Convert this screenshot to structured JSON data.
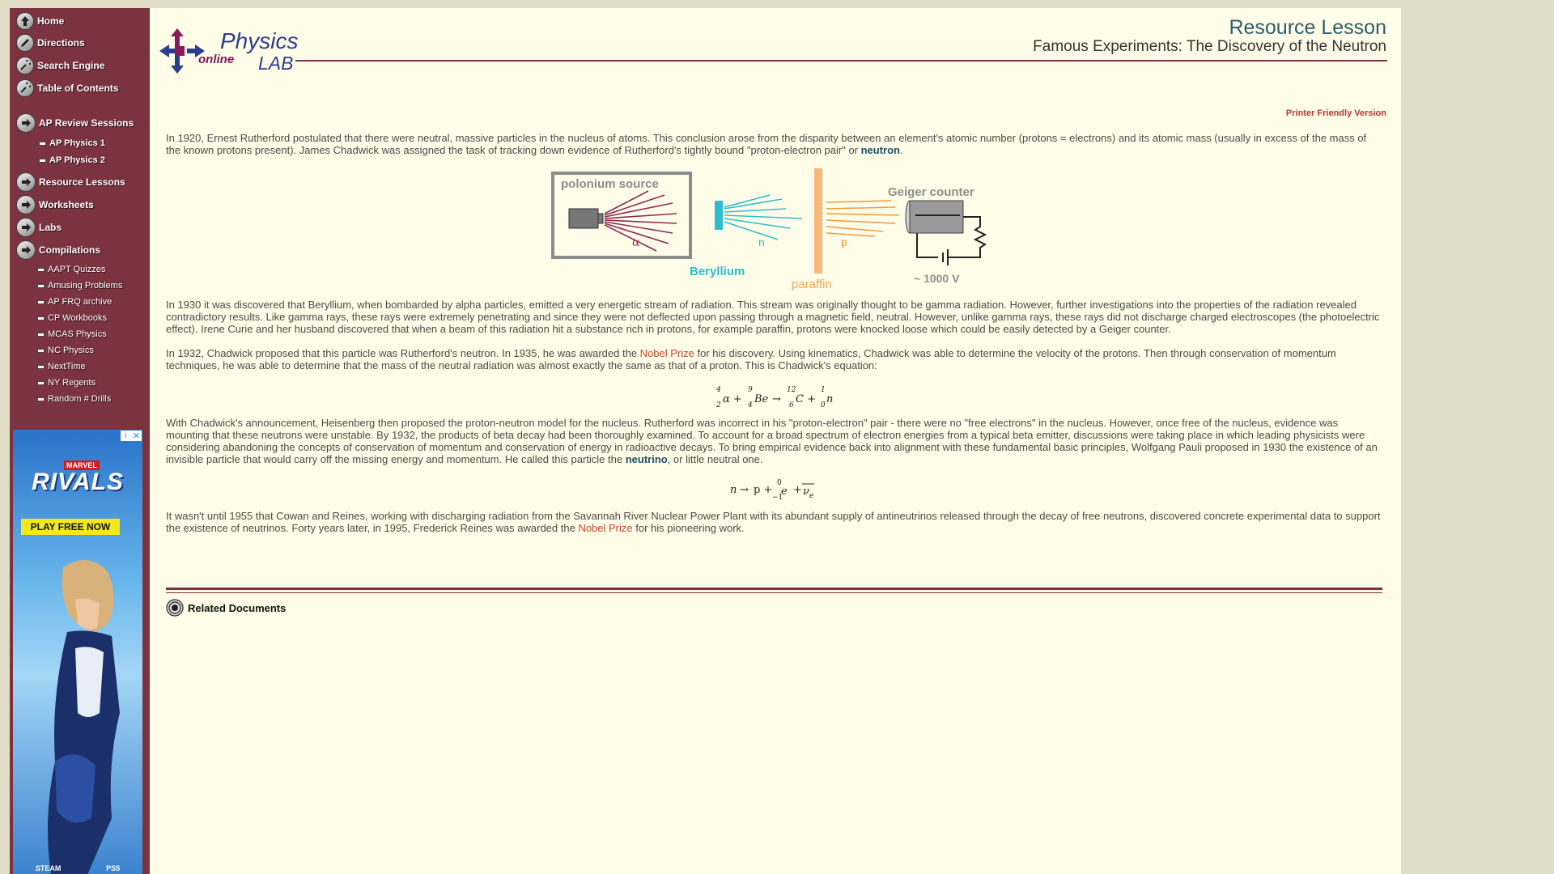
{
  "sidebar": {
    "nav": [
      "Home",
      "Directions",
      "Search Engine",
      "Table of Contents"
    ],
    "ap_review": "AP Review Sessions",
    "ap_sub": [
      "AP Physics 1",
      "AP Physics 2"
    ],
    "sections": [
      "Resource Lessons",
      "Worksheets",
      "Labs",
      "Compilations"
    ],
    "compilations": [
      "AAPT Quizzes",
      "Amusing Problems",
      "AP FRQ archive",
      "CP Workbooks",
      "MCAS Physics",
      "NC Physics",
      "NextTime",
      "NY Regents",
      "Random # Drills"
    ]
  },
  "ad": {
    "marvel": "MARVEL",
    "title": "RIVALS",
    "cta": "PLAY FREE NOW",
    "steam": "STEAM",
    "ps5": "PS5"
  },
  "logo": {
    "physics": "Physics",
    "lab": "LAB",
    "online": "online"
  },
  "header": {
    "title": "Resource Lesson",
    "subtitle": "Famous Experiments: The Discovery of the Neutron"
  },
  "printer_link": "Printer Friendly Version",
  "p1": {
    "a": "In 1920, Ernest Rutherford postulated that there were neutral, massive particles in the nucleus of atoms. This conclusion arose from the disparity between an element's atomic number (protons = electrons) and its atomic mass (usually in excess of the mass of the known protons present). James Chadwick was assigned the task of tracking down evidence of Rutherford's tightly bound \"proton-electron pair\" or ",
    "kw": "neutron",
    "b": "."
  },
  "diagram": {
    "polonium": "polonium source",
    "alpha": "α",
    "beryllium": "Beryllium",
    "n": "n",
    "paraffin": "paraffin",
    "p": "p",
    "geiger": "Geiger counter",
    "voltage": "~ 1000 V"
  },
  "p2": "In 1930 it was discovered that Beryllium, when bombarded by alpha particles, emitted a very energetic stream of radiation. This stream was originally thought to be gamma radiation.  However, further investigations into the properties of the radiation revealed contradictory results. Like gamma rays, these rays were extremely penetrating and since they were not deflected upon passing through a magnetic field, neutral. However, unlike gamma rays, these rays did not discharge charged electroscopes (the photoelectric effect). Irene Curie and her husband discovered that when a beam of this radiation hit a substance rich in protons, for example paraffin, protons were knocked loose which could be easily detected by a Geiger counter.",
  "p3": {
    "a": "In 1932, Chadwick proposed that this particle was Rutherford's neutron. In 1935, he was awarded the ",
    "link": "Nobel Prize",
    "b": " for his discovery. Using kinematics, Chadwick was able to determine the velocity of the protons. Then through conservation of momentum techniques, he was able to determine that the mass of the neutral radiation was almost exactly the same as that of a proton. This is Chadwick's equation:"
  },
  "p4": {
    "a": "With Chadwick's announcement, Heisenberg then proposed the proton-neutron model for the nucleus. Rutherford was incorrect in his \"proton-electron\" pair - there were no \"free electrons\" in the nucleus. However, once free of the nucleus, evidence was mounting that these neutrons were unstable. By 1932, the products of beta decay had been thoroughly examined. To account for a broad spectrum of electron energies from a typical beta emitter, discussions were taking place in which leading physicists were considering abandoning the concepts of conservation of momentum and conservation of energy in radioactive decays. To bring empirical evidence back into alignment with these fundamental basic principles, Wolfgang Pauli proposed in 1930 the existence of an invisible particle that would carry off the missing energy and momentum. He called this particle the ",
    "kw": "neutrino",
    "b": ", or little neutral one."
  },
  "p5": {
    "a": "It wasn't until 1955 that Cowan and Reines, working with discharging radiation from the Savannah River Nuclear Power Plant with its abundant supply of antineutrinos released through the decay of free neutrons, discovered concrete experimental data to support the existence of neutrinos. Forty years later, in 1995, Frederick Reines was awarded the ",
    "link": "Nobel Prize",
    "b": " for his pioneering work."
  },
  "related": "Related Documents"
}
